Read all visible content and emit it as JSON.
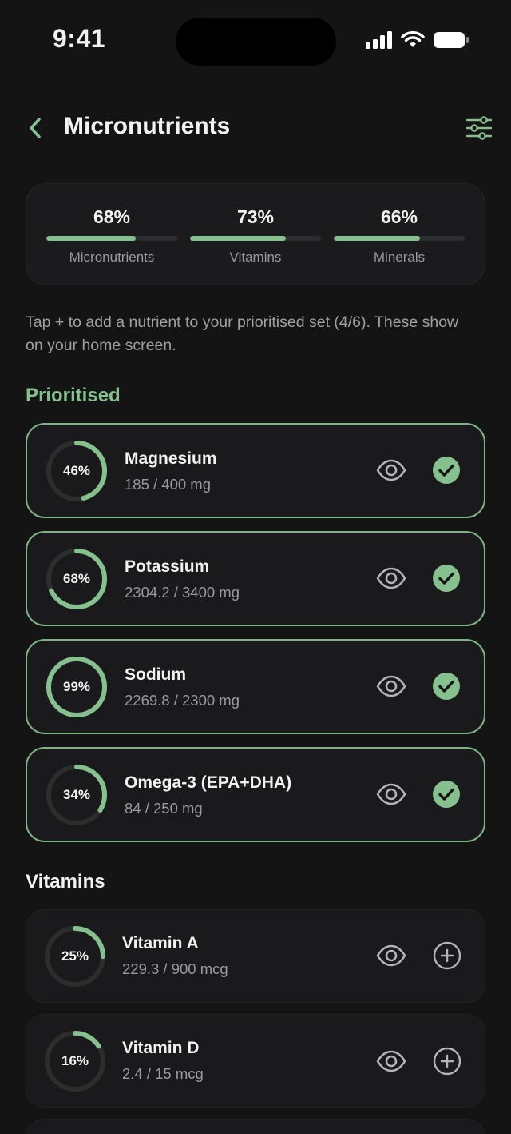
{
  "status": {
    "time": "9:41"
  },
  "header": {
    "title": "Micronutrients"
  },
  "summary": [
    {
      "value": "68%",
      "label": "Micronutrients",
      "progress": 0.68
    },
    {
      "value": "73%",
      "label": "Vitamins",
      "progress": 0.73
    },
    {
      "value": "66%",
      "label": "Minerals",
      "progress": 0.66
    }
  ],
  "hint": "Tap + to add a nutrient to your prioritised set (4/6). These show on your home screen.",
  "sections": {
    "prioritised": {
      "title": "Prioritised",
      "items": [
        {
          "name": "Magnesium",
          "amount": "185 / 400 mg",
          "percent": "46%",
          "progress": 0.46
        },
        {
          "name": "Potassium",
          "amount": "2304.2 / 3400 mg",
          "percent": "68%",
          "progress": 0.68
        },
        {
          "name": "Sodium",
          "amount": "2269.8 / 2300 mg",
          "percent": "99%",
          "progress": 0.99
        },
        {
          "name": "Omega-3 (EPA+DHA)",
          "amount": "84 / 250 mg",
          "percent": "34%",
          "progress": 0.34
        }
      ]
    },
    "vitamins": {
      "title": "Vitamins",
      "items": [
        {
          "name": "Vitamin A",
          "amount": "229.3 / 900 mcg",
          "percent": "25%",
          "progress": 0.25
        },
        {
          "name": "Vitamin D",
          "amount": "2.4 / 15 mcg",
          "percent": "16%",
          "progress": 0.16
        }
      ]
    }
  },
  "colors": {
    "accent": "#86c08e",
    "background": "#141415",
    "card": "#1a1a1c",
    "track": "#2c2e2d"
  },
  "icons": {
    "back": "chevron-left-icon",
    "filter": "sliders-icon",
    "view": "eye-icon",
    "added": "check-circle-icon",
    "add": "plus-circle-icon"
  }
}
